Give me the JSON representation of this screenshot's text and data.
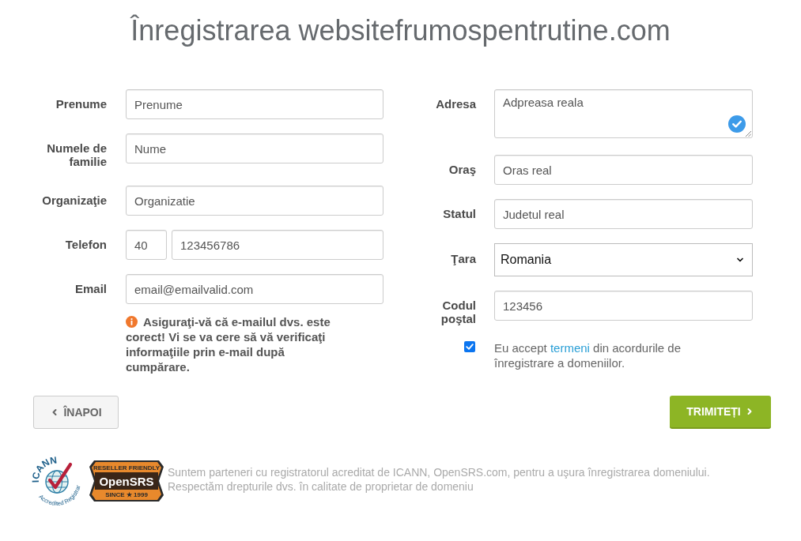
{
  "title": "Înregistrarea websitefrumospentrutine.com",
  "contact": {
    "fields": [
      {
        "kind": "text",
        "label": "Prenume",
        "value": "Prenume"
      },
      {
        "kind": "text",
        "label": "Numele de familie",
        "value": "Nume"
      },
      {
        "kind": "text",
        "label": "Organizaţie",
        "value": "Organizatie"
      },
      {
        "kind": "phone",
        "label": "Telefon",
        "country_code": "40",
        "value": "123456786"
      },
      {
        "kind": "text",
        "label": "Email",
        "value": "email@emailvalid.com"
      }
    ],
    "email_notice": "Asiguraţi-vă că e-mailul dvs. este corect! Vi se va cere să vă verificaţi informaţiile prin e-mail după cumpărare."
  },
  "address": {
    "fields": [
      {
        "kind": "textarea",
        "label": "Adresa",
        "value": "Adpreasa reala",
        "verified": true
      },
      {
        "kind": "text",
        "label": "Oraş",
        "value": "Oras real"
      },
      {
        "kind": "text",
        "label": "Statul",
        "value": "Judetul real"
      },
      {
        "kind": "select",
        "label": "Ţara",
        "value": "Romania"
      },
      {
        "kind": "text",
        "label": "Codul poştal",
        "value": "123456"
      }
    ],
    "terms": {
      "checked": true,
      "text_before": "Eu accept",
      "link": "termeni",
      "text_after": "din acordurile de înregistrare a domeniilor."
    }
  },
  "buttons": {
    "back": "ÎNAPOI",
    "submit": "TRIMITEȚI"
  },
  "footer": {
    "icann_logo": {
      "name": "ICANN",
      "caption": "Accredited Registrar"
    },
    "opensrs_logo": {
      "tagline": "RESELLER FRIENDLY",
      "name": "OpenSRS",
      "since": "SINCE ★ 1999"
    },
    "lines": [
      "Suntem parteneri cu registratorul acreditat de ICANN, OpenSRS.com, pentru a uşura înregistrarea domeniului.",
      "Respectăm drepturile dvs. în calitate de proprietar de domeniu"
    ]
  }
}
